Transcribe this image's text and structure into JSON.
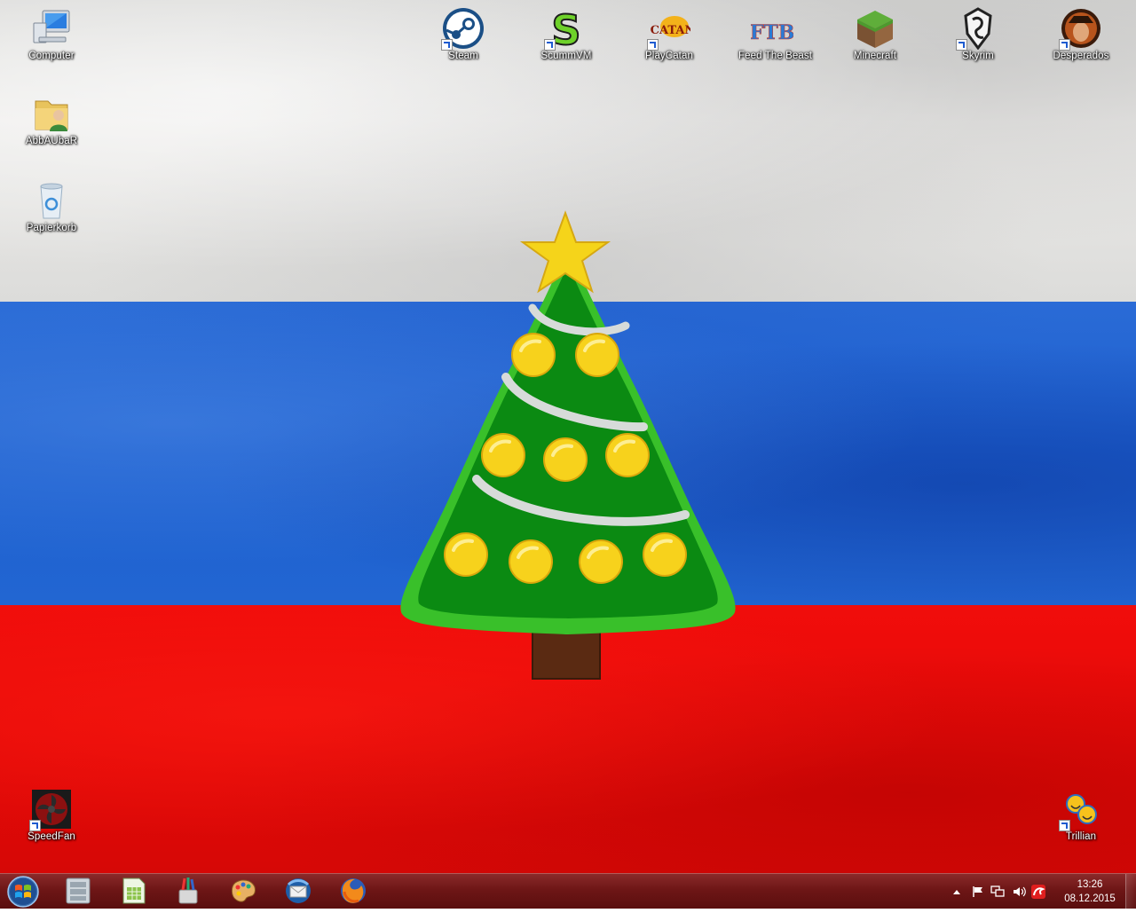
{
  "desktop": {
    "wallpaper": {
      "colors": {
        "white": "#e4e3e1",
        "blue": "#1f62d2",
        "red": "#e60a08"
      },
      "tree_colors": {
        "green": "#0b8a12",
        "light_green": "#39c02a",
        "ornament": "#f7d21c",
        "star": "#f5d41a",
        "garland": "#d7dbd9",
        "trunk": "#5a2a12"
      }
    },
    "icons": [
      {
        "name": "Computer",
        "icon": "computer-icon",
        "shortcut": false
      },
      {
        "name": "AbbAUbaR",
        "icon": "user-folder-icon",
        "shortcut": false
      },
      {
        "name": "Papierkorb",
        "icon": "recycle-bin-icon",
        "shortcut": false
      },
      {
        "name": "Steam",
        "icon": "steam-icon",
        "shortcut": true
      },
      {
        "name": "ScummVM",
        "icon": "scummvm-icon",
        "shortcut": true
      },
      {
        "name": "PlayCatan",
        "icon": "playcatan-icon",
        "shortcut": true
      },
      {
        "name": "Feed The Beast",
        "icon": "feed-the-beast-icon",
        "shortcut": false
      },
      {
        "name": "Minecraft",
        "icon": "minecraft-icon",
        "shortcut": false
      },
      {
        "name": "Skyrim",
        "icon": "skyrim-icon",
        "shortcut": true
      },
      {
        "name": "Desperados",
        "icon": "desperados-icon",
        "shortcut": true
      },
      {
        "name": "SpeedFan",
        "icon": "speedfan-icon",
        "shortcut": true
      },
      {
        "name": "Trillian",
        "icon": "trillian-icon",
        "shortcut": true
      }
    ],
    "ftb_letters": "FTB",
    "catan_text": "CATAN",
    "scummvm_letter": "S"
  },
  "taskbar": {
    "start": {
      "icon": "windows-start-icon"
    },
    "pinned": [
      {
        "icon": "file-cabinet-icon"
      },
      {
        "icon": "spreadsheet-icon"
      },
      {
        "icon": "paint-brushes-icon"
      },
      {
        "icon": "paint-palette-icon"
      },
      {
        "icon": "thunderbird-mail-icon"
      },
      {
        "icon": "firefox-icon"
      }
    ],
    "tray": {
      "icons": [
        "show-hidden-icons-arrow",
        "action-center-flag-icon",
        "network-icon",
        "volume-icon",
        "avira-antivirus-icon"
      ],
      "time": "13:26",
      "date": "08.12.2015"
    }
  }
}
